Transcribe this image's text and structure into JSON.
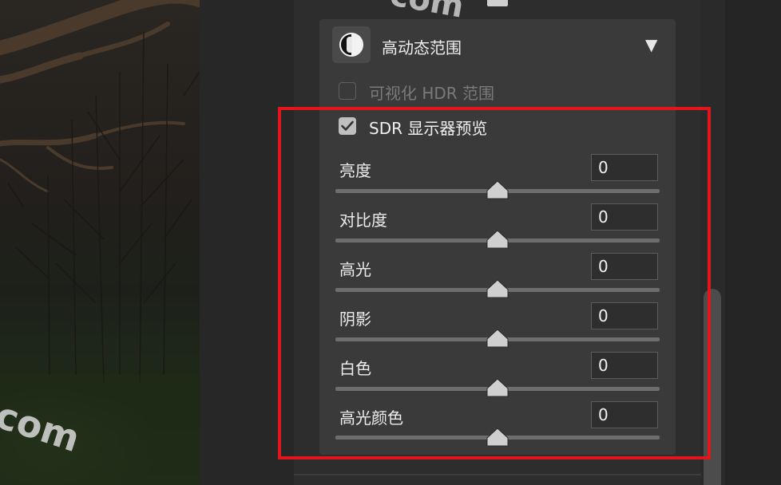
{
  "watermarks": [
    "com",
    "com"
  ],
  "panel": {
    "title": "高动态范围",
    "title_icon": "hdr-circle-icon",
    "collapse_icon": "triangle-down-icon",
    "checkboxes": [
      {
        "label": "可视化 HDR 范围",
        "checked": false,
        "enabled": false
      },
      {
        "label": "SDR 显示器预览",
        "checked": true,
        "enabled": true
      }
    ],
    "sliders": [
      {
        "label": "亮度",
        "value": "0"
      },
      {
        "label": "对比度",
        "value": "0"
      },
      {
        "label": "高光",
        "value": "0"
      },
      {
        "label": "阴影",
        "value": "0"
      },
      {
        "label": "白色",
        "value": "0"
      },
      {
        "label": "高光颜色",
        "value": "0"
      }
    ]
  },
  "colors": {
    "highlight_box": "#e3141a",
    "panel_bg": "#3a3a3a"
  }
}
